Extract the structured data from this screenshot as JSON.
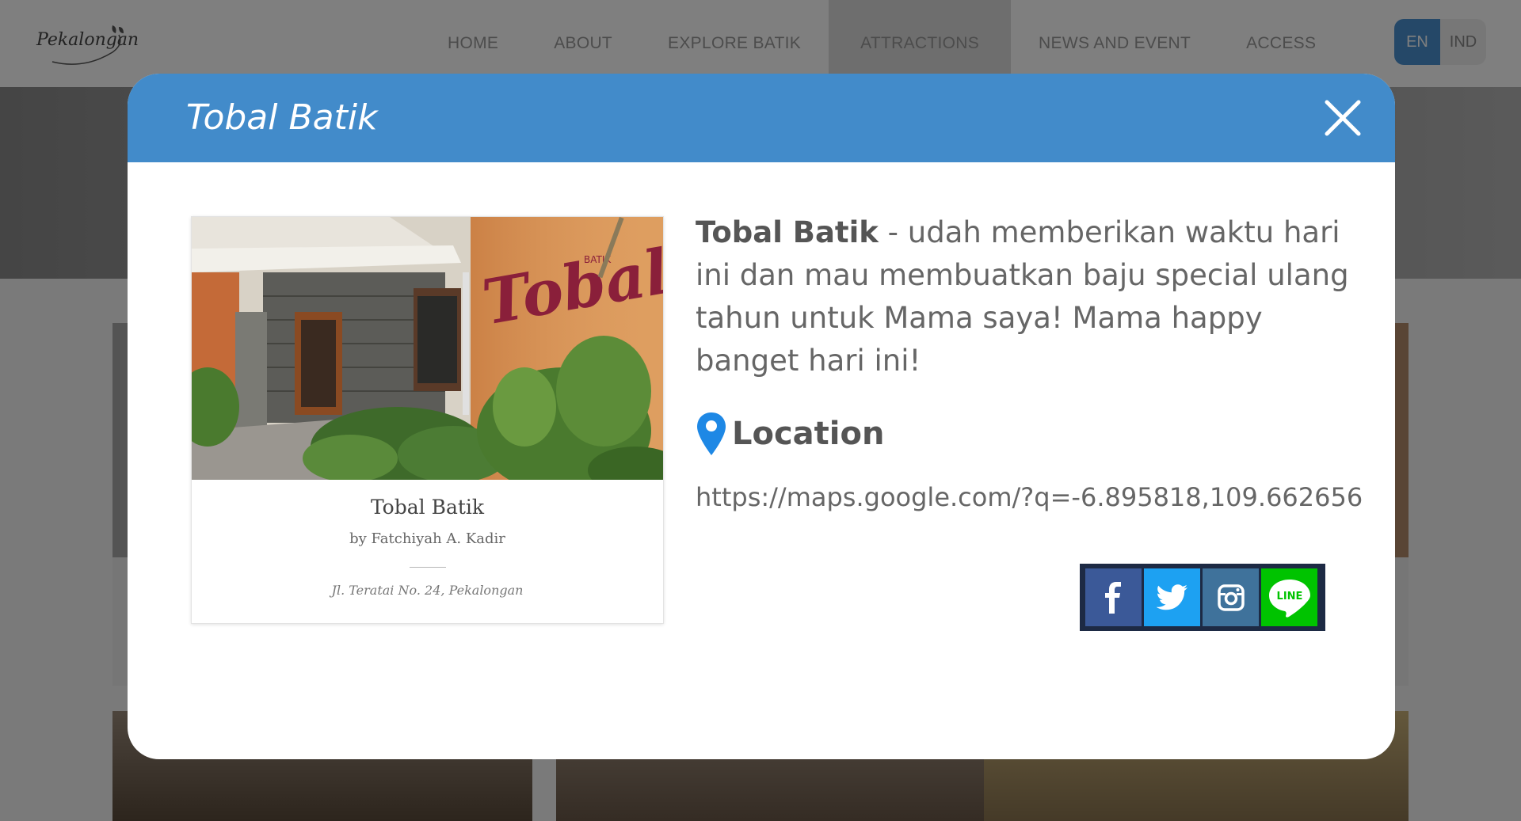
{
  "site": {
    "logo_text": "Pekalongan",
    "nav": [
      "HOME",
      "ABOUT",
      "EXPLORE BATIK",
      "ATTRACTIONS",
      "NEWS AND EVENT",
      "ACCESS"
    ],
    "active_nav": "ATTRACTIONS",
    "lang": {
      "en": "EN",
      "ind": "IND",
      "active": "EN"
    }
  },
  "modal": {
    "title": "Tobal Batik",
    "close_icon": "close-icon",
    "header_color": "#428bca",
    "card": {
      "image_alt": "Tobal Batik storefront",
      "image_sign_small": "BATIK",
      "image_sign_large": "Tobal",
      "title": "Tobal Batik",
      "author": "by Fatchiyah A. Kadir",
      "address": "Jl. Teratai No. 24, Pekalongan"
    },
    "description": {
      "name": "Tobal Batik",
      "text": " - udah memberikan waktu hari ini dan mau membuatkan baju special ulang tahun untuk Mama saya! Mama happy banget hari ini!"
    },
    "location": {
      "icon": "map-pin-icon",
      "label": "Location",
      "url": "https://maps.google.com/?q=-6.895818,109.662656"
    },
    "share": [
      {
        "name": "facebook",
        "icon": "facebook-icon",
        "color": "#3b5998"
      },
      {
        "name": "twitter",
        "icon": "twitter-icon",
        "color": "#1da1f2"
      },
      {
        "name": "instagram",
        "icon": "instagram-icon",
        "color": "#3f729b"
      },
      {
        "name": "line",
        "icon": "line-icon",
        "label": "LINE",
        "color": "#00c300"
      }
    ]
  }
}
